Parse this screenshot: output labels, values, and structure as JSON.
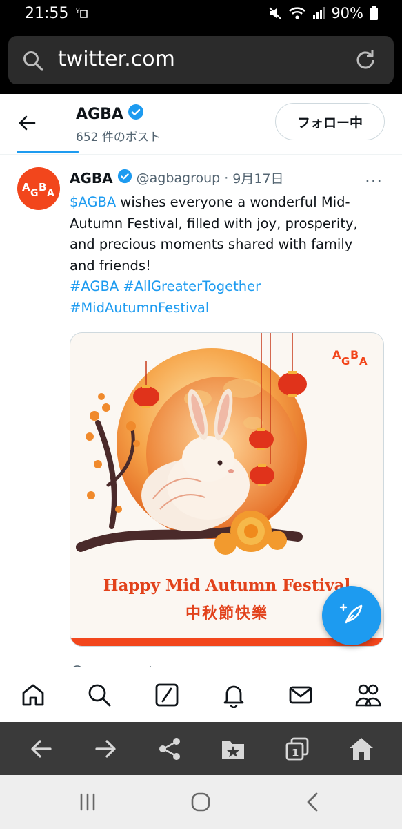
{
  "status_bar": {
    "time": "21:55",
    "sim_icon": "sim-status-icon",
    "battery": "90%"
  },
  "browser": {
    "url": "twitter.com"
  },
  "profile_header": {
    "name": "AGBA",
    "post_count": "652 件のポスト",
    "follow_label": "フォロー中"
  },
  "tweet": {
    "name": "AGBA",
    "handle": "@agbagroup",
    "separator": "·",
    "date": "9月17日",
    "more": "···",
    "text_cashtag": "$AGBA",
    "text_body": " wishes everyone a wonderful Mid-Autumn Festival, filled with joy, prosperity, and precious moments shared with family and friends!",
    "hashtag_1": "#AGBA",
    "hashtag_2": "#AllGreaterTogether",
    "hashtag_3": "#MidAutumnFestival",
    "media": {
      "logo_text": "AGBA",
      "title": "Happy Mid Autumn Festival",
      "subtitle": "中秋節快樂"
    }
  },
  "colors": {
    "link": "#1d9bf0",
    "brand": "#f2461c",
    "verified": "#1d9bf0"
  }
}
